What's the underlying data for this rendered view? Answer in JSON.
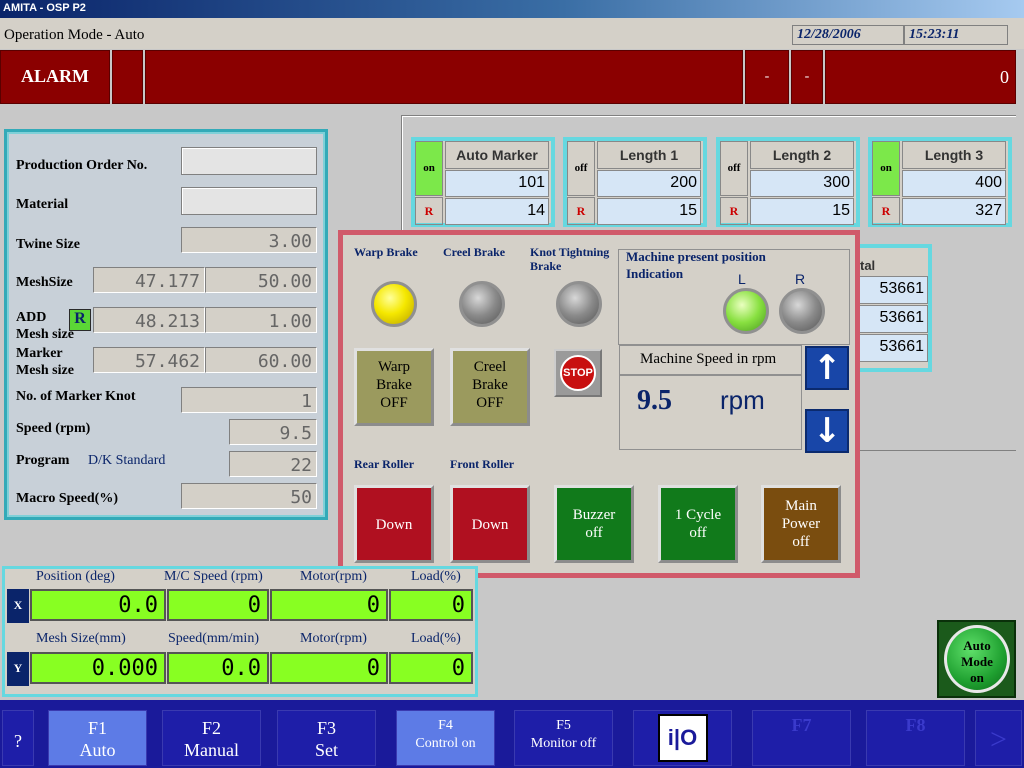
{
  "window_title": "AMITA - OSP P2",
  "mode": "Operation Mode - Auto",
  "date": "12/28/2006",
  "time": "15:23:11",
  "alarm": {
    "label": "ALARM",
    "f1": "-",
    "f2": "-",
    "count": "0"
  },
  "form": {
    "production_order_label": "Production Order No.",
    "material_label": "Material",
    "twine_label": "Twine Size",
    "twine": "3.00",
    "meshsize_label": "MeshSize",
    "meshsize_a": "47.177",
    "meshsize_b": "50.00",
    "add_label": "ADD",
    "add_sub": "Mesh size",
    "add_r": "R",
    "add_a": "48.213",
    "add_b": "1.00",
    "marker_label": "Marker",
    "marker_sub": "Mesh size",
    "marker_a": "57.462",
    "marker_b": "60.00",
    "knot_label": "No. of Marker Knot",
    "knot": "1",
    "speed_label": "Speed (rpm)",
    "speed": "9.5",
    "program_label": "Program",
    "program_name": "D/K Standard",
    "program": "22",
    "macro_label": "Macro Speed(%)",
    "macro": "50"
  },
  "markers": [
    {
      "state": "on",
      "r": "R",
      "title": "Auto Marker",
      "v1": "101",
      "v2": "14"
    },
    {
      "state": "off",
      "r": "R",
      "title": "Length 1",
      "v1": "200",
      "v2": "15"
    },
    {
      "state": "off",
      "r": "R",
      "title": "Length 2",
      "v1": "300",
      "v2": "15"
    },
    {
      "state": "on",
      "r": "R",
      "title": "Length 3",
      "v1": "400",
      "v2": "327"
    }
  ],
  "total": {
    "label": "tal",
    "v1": "53661",
    "v2": "53661",
    "v3": "53661"
  },
  "modal": {
    "warp_brake": "Warp Brake",
    "creel_brake": "Creel Brake",
    "knot_brake_1": "Knot Tightning",
    "knot_brake_2": "Brake",
    "position_title_1": "Machine present position",
    "position_title_2": "Indication",
    "pos_l": "L",
    "pos_r": "R",
    "warp_btn_1": "Warp",
    "warp_btn_2": "Brake",
    "warp_btn_3": "OFF",
    "creel_btn_1": "Creel",
    "creel_btn_2": "Brake",
    "creel_btn_3": "OFF",
    "stop": "STOP",
    "speed_title": "Machine Speed in rpm",
    "speed_value": "9.5",
    "speed_unit": "rpm",
    "up_icon": "↑",
    "down_icon": "↓",
    "rear_roller": "Rear Roller",
    "front_roller": "Front Roller",
    "rear_btn": "Down",
    "front_btn": "Down",
    "buzzer_1": "Buzzer",
    "buzzer_2": "off",
    "cycle_1": "1 Cycle",
    "cycle_2": "off",
    "power_1": "Main",
    "power_2": "Power",
    "power_3": "off"
  },
  "xy": {
    "x_axis": "X",
    "y_axis": "Y",
    "x_labels": [
      "Position (deg)",
      "M/C Speed (rpm)",
      "Motor(rpm)",
      "Load(%)"
    ],
    "x_values": [
      "0.0",
      "0",
      "0",
      "0"
    ],
    "y_labels": [
      "Mesh Size(mm)",
      "Speed(mm/min)",
      "Motor(rpm)",
      "Load(%)"
    ],
    "y_values": [
      "0.000",
      "0.0",
      "0",
      "0"
    ]
  },
  "auto_mode": {
    "line1": "Auto",
    "line2": "Mode",
    "line3": "on"
  },
  "fkeys": {
    "help": "?",
    "f1": "F1",
    "f1_sub": "Auto",
    "f2": "F2",
    "f2_sub": "Manual",
    "f3": "F3",
    "f3_sub": "Set",
    "f4": "F4",
    "f4_sub": "Control on",
    "f5": "F5",
    "f5_sub": "Monitor off",
    "io_label": "i|O",
    "f7": "F7",
    "f8": "F8",
    "next": ">"
  },
  "colors": {
    "alarm": "#8b0000",
    "lamp_yellow": "#f5e800",
    "lamp_green": "#88e040",
    "lamp_gray": "#8a8a8a",
    "fbar": "#1a1a9a"
  }
}
